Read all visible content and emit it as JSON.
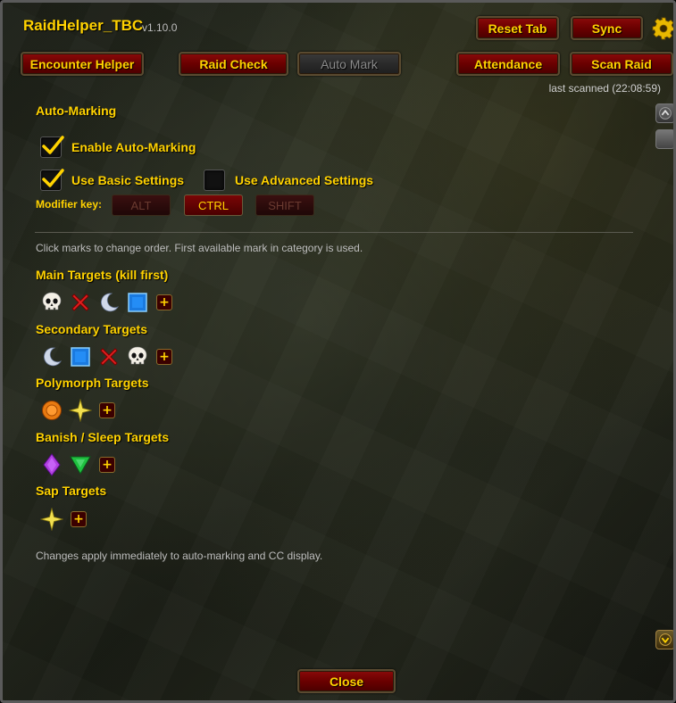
{
  "header": {
    "title": "RaidHelper_TBC",
    "version": "v1.10.0"
  },
  "toolbar": {
    "reset_tab": "Reset Tab",
    "sync": "Sync",
    "settings_icon": "gear-icon"
  },
  "tabs": [
    {
      "label": "Encounter Helper",
      "active": false
    },
    {
      "label": "Raid Check",
      "active": false
    },
    {
      "label": "Auto Mark",
      "active": true
    }
  ],
  "actions": {
    "attendance": "Attendance",
    "scan_raid": "Scan Raid",
    "last_scanned": "last scanned (22:08:59)"
  },
  "auto_marking": {
    "heading": "Auto-Marking",
    "enable_label": "Enable Auto-Marking",
    "enable_checked": true,
    "basic_label": "Use Basic Settings",
    "basic_checked": true,
    "advanced_label": "Use Advanced Settings",
    "advanced_checked": false,
    "modifier_label": "Modifier key:",
    "modifiers": [
      {
        "label": "ALT",
        "selected": false
      },
      {
        "label": "CTRL",
        "selected": true
      },
      {
        "label": "SHIFT",
        "selected": false
      }
    ]
  },
  "hint_top": "Click marks to change order. First available mark in category is used.",
  "categories": [
    {
      "title": "Main Targets (kill first)",
      "marks": [
        "skull-icon",
        "cross-icon",
        "moon-icon",
        "square-icon"
      ]
    },
    {
      "title": "Secondary Targets",
      "marks": [
        "moon-icon",
        "square-icon",
        "cross-icon",
        "skull-icon"
      ]
    },
    {
      "title": "Polymorph Targets",
      "marks": [
        "circle-icon",
        "star-icon"
      ]
    },
    {
      "title": "Banish / Sleep Targets",
      "marks": [
        "diamond-icon",
        "triangle-icon"
      ]
    },
    {
      "title": "Sap Targets",
      "marks": [
        "star-icon"
      ]
    }
  ],
  "add_symbol": "+",
  "hint_bottom": "Changes apply immediately to auto-marking and CC display.",
  "close_label": "Close",
  "colors": {
    "gold": "#ffd200",
    "button_red": "#6a0000"
  }
}
